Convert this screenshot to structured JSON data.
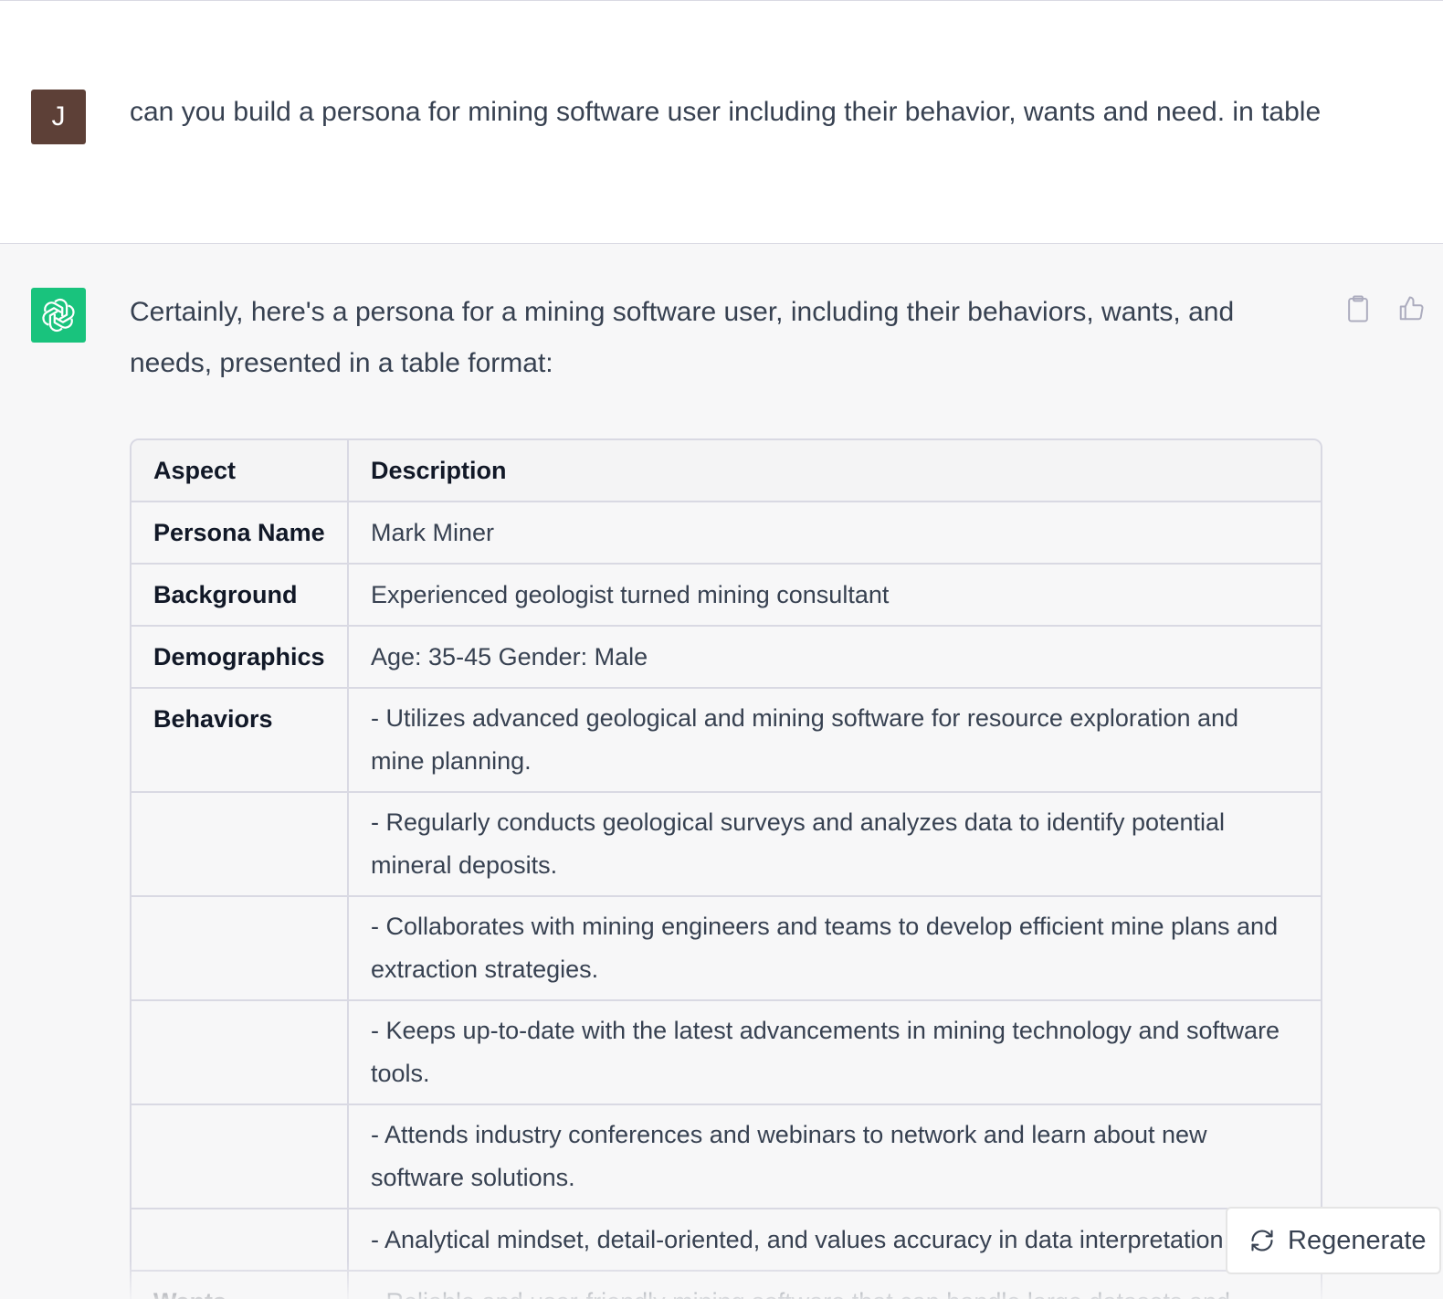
{
  "user": {
    "avatar_letter": "J",
    "message": "can you build a persona for mining software user including their behavior, wants and need. in table"
  },
  "assistant": {
    "intro": "Certainly, here's a persona for a mining software user, including their behaviors, wants, and needs, presented in a table format:",
    "table": {
      "headers": [
        "Aspect",
        "Description"
      ],
      "rows": [
        {
          "aspect": "Persona Name",
          "description": "Mark Miner"
        },
        {
          "aspect": "Background",
          "description": "Experienced geologist turned mining consultant"
        },
        {
          "aspect": "Demographics",
          "description": "Age: 35-45 Gender: Male"
        },
        {
          "aspect": "Behaviors",
          "description": "- Utilizes advanced geological and mining software for resource exploration and mine planning."
        },
        {
          "aspect": "",
          "description": "- Regularly conducts geological surveys and analyzes data to identify potential mineral deposits."
        },
        {
          "aspect": "",
          "description": "- Collaborates with mining engineers and teams to develop efficient mine plans and extraction strategies."
        },
        {
          "aspect": "",
          "description": "- Keeps up-to-date with the latest advancements in mining technology and software tools."
        },
        {
          "aspect": "",
          "description": "- Attends industry conferences and webinars to network and learn about new software solutions."
        },
        {
          "aspect": "",
          "description": "- Analytical mindset, detail-oriented, and values accuracy in data interpretation."
        },
        {
          "aspect": "Wants",
          "description": "- Reliable and user-friendly mining software that can handle large datasets and"
        }
      ]
    }
  },
  "controls": {
    "regenerate_label": "Regenerate",
    "copy_icon": "clipboard-icon",
    "like_icon": "thumbs-up-icon"
  },
  "colors": {
    "user_avatar": "#5d4037",
    "assistant_avatar": "#19c37d",
    "assistant_bg": "#f7f7f8"
  }
}
